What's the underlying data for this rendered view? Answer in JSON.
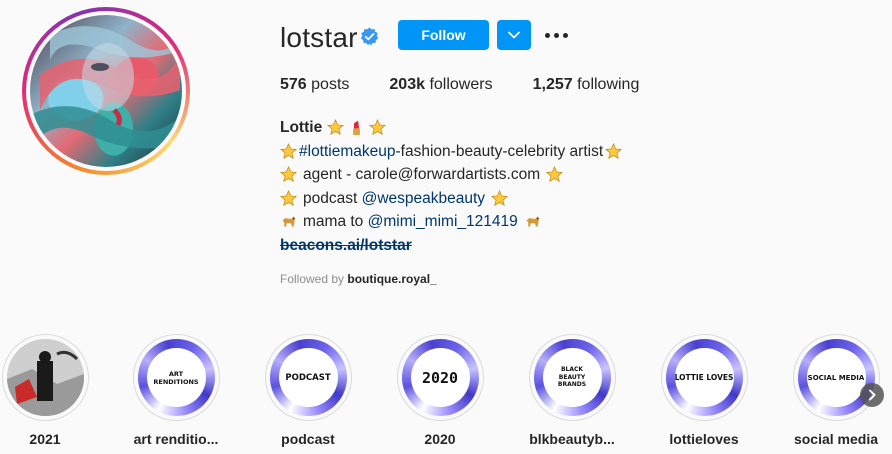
{
  "profile": {
    "username": "lotstar",
    "verified": true,
    "avatar_icon": "profile-photo"
  },
  "actions": {
    "follow_label": "Follow",
    "dropdown_icon": "chevron-down-icon",
    "more_icon": "more-options-icon"
  },
  "stats": {
    "posts_count": "576",
    "posts_label": "posts",
    "followers_count": "203k",
    "followers_label": "followers",
    "following_count": "1,257",
    "following_label": "following"
  },
  "bio": {
    "name": "Lottie",
    "line1_hashtag": "#lottiemakeup",
    "line1_text": "-fashion-beauty-celebrity artist",
    "line2_text": "agent - carole@forwardartists.com",
    "line3_text": "podcast ",
    "line3_mention": "@wespeakbeauty",
    "line4_text": "mama to ",
    "line4_mention": "@mimi_mimi_121419",
    "link": "beacons.ai/lotstar"
  },
  "followed_by": {
    "prefix": "Followed by ",
    "user": "boutique.royal_"
  },
  "highlights": [
    {
      "label": "2021",
      "cover_text": ""
    },
    {
      "label": "art renditio...",
      "cover_text": "ART RENDITIONS"
    },
    {
      "label": "podcast",
      "cover_text": "PODCAST"
    },
    {
      "label": "2020",
      "cover_text": "2020"
    },
    {
      "label": "blkbeautyb...",
      "cover_text": "BLACK BEAUTY BRANDS"
    },
    {
      "label": "lottieloves",
      "cover_text": "LOTTIE LOVES"
    },
    {
      "label": "social media",
      "cover_text": "SOCIAL MEDIA"
    }
  ],
  "colors": {
    "accent": "#0095f6",
    "link": "#00376b",
    "text": "#262626",
    "muted": "#8e8e8e",
    "background": "#fafafa"
  }
}
